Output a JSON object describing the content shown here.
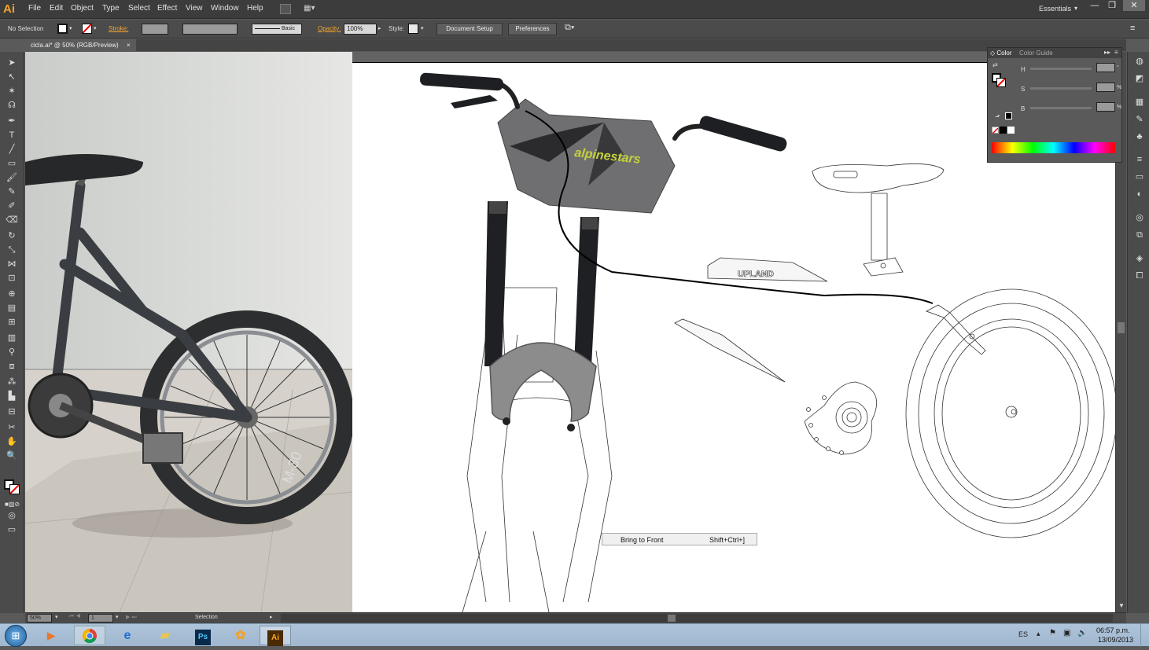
{
  "app": {
    "logo": "Ai",
    "workspace": "Essentials"
  },
  "menu": [
    "File",
    "Edit",
    "Object",
    "Type",
    "Select",
    "Effect",
    "View",
    "Window",
    "Help"
  ],
  "window_controls": {
    "minimize": "—",
    "maximize": "❐",
    "close": "✕"
  },
  "control": {
    "selection": "No Selection",
    "stroke_label": "Stroke:",
    "brush": "Basic",
    "opacity_label": "Opacity:",
    "opacity_value": "100%",
    "style_label": "Style:",
    "doc_setup": "Document Setup",
    "preferences": "Preferences"
  },
  "document": {
    "tab": "cicla.ai* @ 50% (RGB/Preview)",
    "close": "×"
  },
  "status": {
    "zoom": "50%",
    "artboard": "1",
    "tool": "Selection"
  },
  "context_tip": {
    "label": "Bring to Front",
    "shortcut": "Shift+Ctrl+]"
  },
  "color_panel": {
    "tab_color": "Color",
    "tab_guide": "Color Guide",
    "channels": [
      {
        "label": "H",
        "unit": "°"
      },
      {
        "label": "S",
        "unit": "%"
      },
      {
        "label": "B",
        "unit": "%"
      }
    ]
  },
  "artwork": {
    "brand_text": "alpinestars",
    "frame_text": "UPLAND"
  },
  "taskbar": {
    "apps": [
      "Ps",
      "Ai"
    ],
    "lang": "ES",
    "time": "06:57 p.m.",
    "date": "13/09/2013"
  },
  "colors": {
    "accent_orange": "#f4a52c",
    "panel_dark": "#3c3c3c",
    "canvas_gray": "#636363"
  }
}
